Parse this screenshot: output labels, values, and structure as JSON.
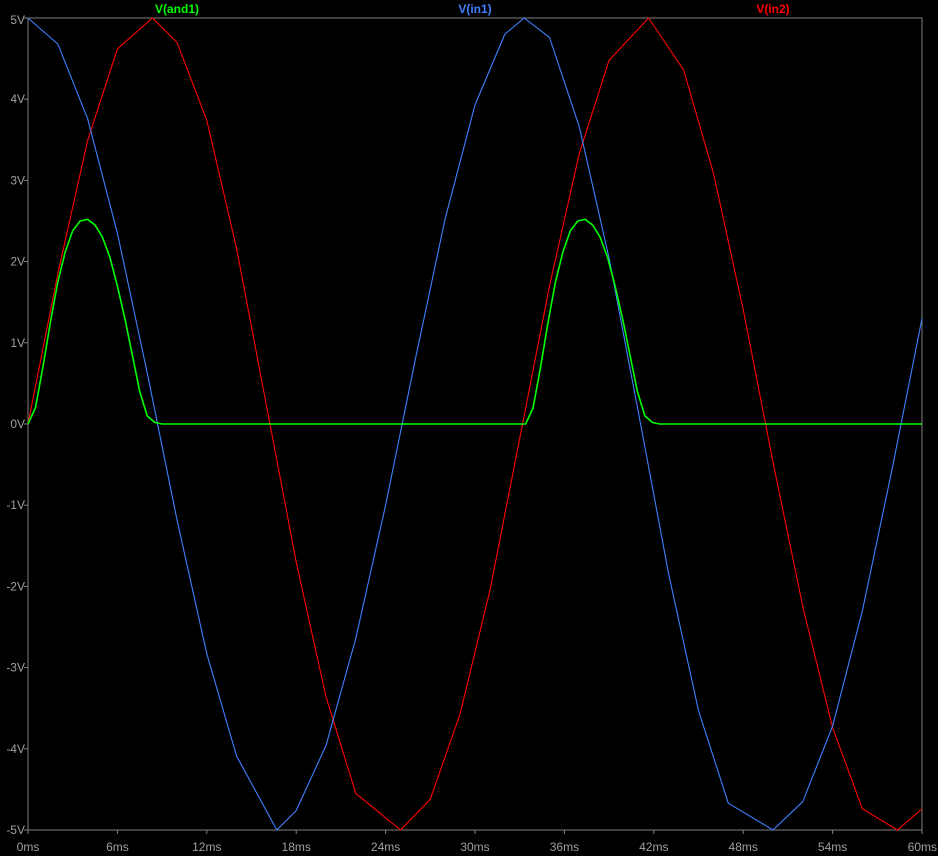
{
  "chart_data": {
    "type": "line",
    "title": "",
    "xlabel": "",
    "ylabel": "",
    "xlim": [
      0,
      60
    ],
    "ylim": [
      -5,
      5
    ],
    "x_unit": "ms",
    "y_unit": "V",
    "grid": false,
    "legend_placement": "top",
    "background": "#000000",
    "axis_color": "#808080",
    "x_ticks": [
      0,
      6,
      12,
      18,
      24,
      30,
      36,
      42,
      48,
      54,
      60
    ],
    "x_tick_labels": [
      "0ms",
      "6ms",
      "12ms",
      "18ms",
      "24ms",
      "30ms",
      "36ms",
      "42ms",
      "48ms",
      "54ms",
      "60ms"
    ],
    "y_ticks": [
      5,
      4,
      3,
      2,
      1,
      0,
      -1,
      -2,
      -3,
      -4,
      -5
    ],
    "y_tick_labels": [
      "5V",
      "4V",
      "3V",
      "2V",
      "1V",
      "0V",
      "-1V",
      "-2V",
      "-3V",
      "-4V",
      "-5V"
    ],
    "series": [
      {
        "name": "V(and1)",
        "color": "#00ff00",
        "x": [
          0,
          0.5,
          1,
          1.5,
          2,
          2.5,
          3,
          3.5,
          4,
          4.5,
          5,
          5.5,
          6,
          6.5,
          7,
          7.5,
          8,
          8.5,
          9,
          10,
          12,
          15,
          18,
          21,
          24,
          27,
          30,
          32,
          33.4,
          33.9,
          34.4,
          34.9,
          35.4,
          35.9,
          36.4,
          36.9,
          37.4,
          37.9,
          38.4,
          38.9,
          39.4,
          39.9,
          40.4,
          40.9,
          41.4,
          41.9,
          42.4,
          43.4,
          45,
          48,
          51,
          54,
          57,
          60
        ],
        "y": [
          0,
          0.2,
          0.7,
          1.25,
          1.75,
          2.12,
          2.38,
          2.5,
          2.52,
          2.45,
          2.3,
          2.05,
          1.7,
          1.3,
          0.85,
          0.4,
          0.1,
          0.02,
          0,
          0,
          0,
          0,
          0,
          0,
          0,
          0,
          0,
          0,
          0,
          0.2,
          0.7,
          1.25,
          1.75,
          2.12,
          2.38,
          2.5,
          2.52,
          2.45,
          2.3,
          2.05,
          1.7,
          1.3,
          0.85,
          0.4,
          0.1,
          0.02,
          0,
          0,
          0,
          0,
          0,
          0,
          0,
          0
        ]
      },
      {
        "name": "V(in1)",
        "color": "#3f80ff",
        "x": [
          0,
          2,
          4,
          6,
          8,
          10,
          12,
          14,
          16.7,
          18,
          20,
          22,
          24,
          26,
          28,
          30,
          32,
          33.3,
          35,
          37,
          39,
          41,
          43,
          45,
          47,
          50,
          52,
          54,
          56,
          58,
          60
        ],
        "y": [
          5,
          4.68,
          3.76,
          2.35,
          0.63,
          -1.18,
          -2.83,
          -4.09,
          -5,
          -4.76,
          -3.96,
          -2.64,
          -1.0,
          0.8,
          2.53,
          3.93,
          4.8,
          5,
          4.76,
          3.66,
          2.04,
          0.11,
          -1.85,
          -3.53,
          -4.67,
          -5,
          -4.65,
          -3.72,
          -2.3,
          -0.55,
          1.3
        ]
      },
      {
        "name": "V(in2)",
        "color": "#ff0000",
        "x": [
          0,
          2,
          4,
          6,
          8.35,
          10,
          12,
          14,
          16,
          18,
          20,
          22,
          25,
          27,
          29,
          31,
          33,
          35,
          37,
          39,
          41.65,
          44,
          46,
          48,
          50,
          52,
          54,
          56,
          58.35,
          60
        ],
        "y": [
          0,
          1.85,
          3.49,
          4.62,
          5,
          4.7,
          3.74,
          2.16,
          0.23,
          -1.7,
          -3.36,
          -4.55,
          -5,
          -4.62,
          -3.57,
          -2.05,
          -0.18,
          1.7,
          3.33,
          4.48,
          5,
          4.36,
          3.09,
          1.41,
          -0.47,
          -2.25,
          -3.74,
          -4.74,
          -5,
          -4.74
        ]
      }
    ]
  }
}
